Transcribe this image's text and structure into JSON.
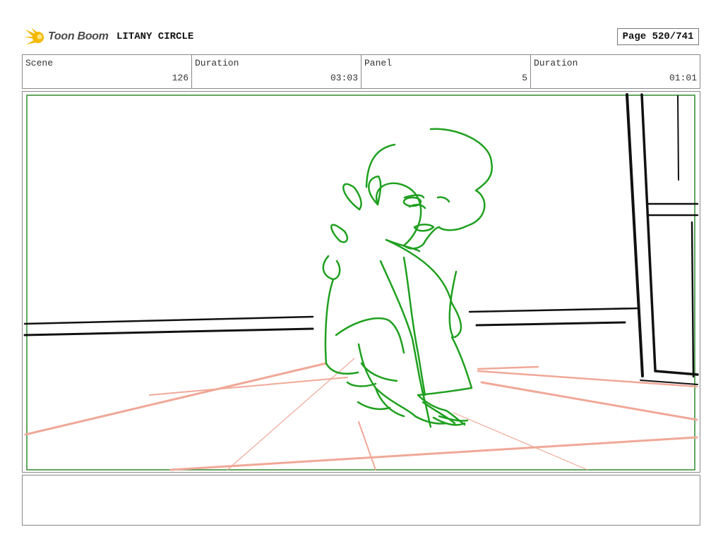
{
  "header": {
    "logo_text": "Toon Boom",
    "project_title": "LITANY CIRCLE",
    "page_label": "Page 520/741"
  },
  "info": {
    "scene_label": "Scene",
    "scene_value": "126",
    "scene_duration_label": "Duration",
    "scene_duration_value": "03:03",
    "panel_label": "Panel",
    "panel_value": "5",
    "panel_duration_label": "Duration",
    "panel_duration_value": "01:01"
  },
  "colors": {
    "frame_green": "#2e8b2e",
    "sketch_green": "#1fa01f",
    "perspective_red": "#f0a898",
    "ink_black": "#111111",
    "logo_yellow": "#f5b800"
  },
  "notes": ""
}
